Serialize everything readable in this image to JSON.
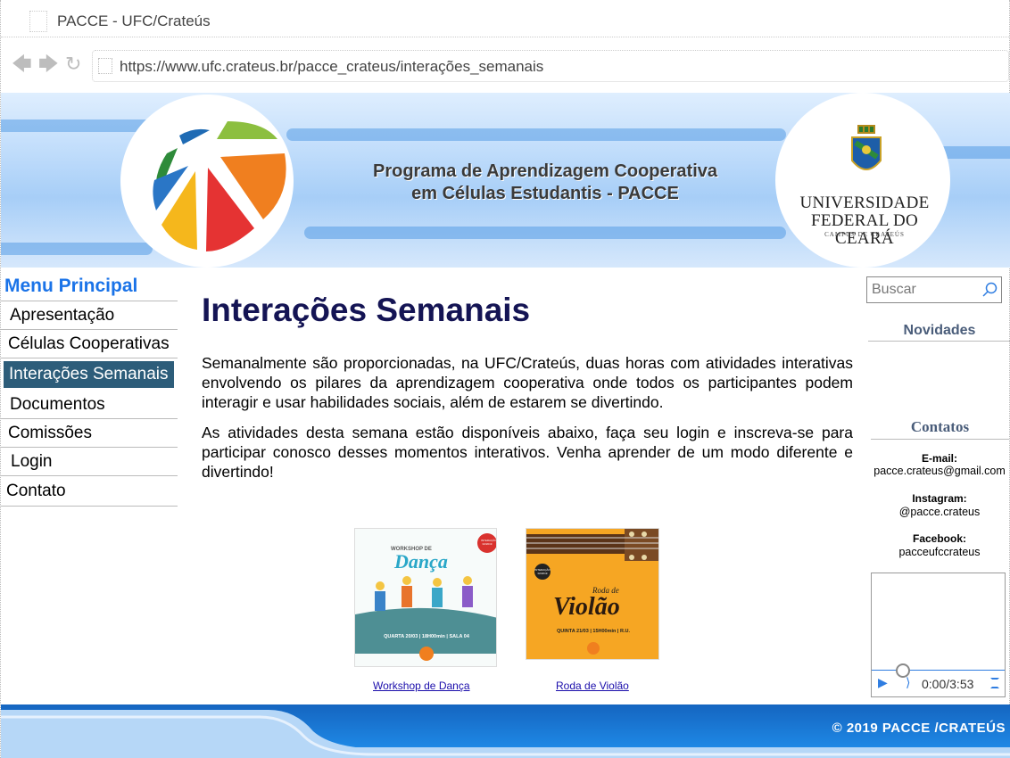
{
  "browser": {
    "tab_title": "PACCE - UFC/Crateús",
    "url": "https://www.ufc.crateus.br/pacce_crateus/interações_semanais"
  },
  "banner": {
    "program_line1": "Programa de Aprendizagem Cooperativa",
    "program_line2": "em Células Estudantis - PACCE",
    "university_line1": "UNIVERSIDADE",
    "university_line2": "FEDERAL DO CEARÁ",
    "university_campus": "CAMPUS DE CRATEÚS"
  },
  "menu": {
    "title": "Menu Principal",
    "items": [
      {
        "label": "Apresentação"
      },
      {
        "label": "Células Cooperativas"
      },
      {
        "label": "Interações Semanais",
        "active": true
      },
      {
        "label": "Documentos"
      },
      {
        "label": "Comissões"
      },
      {
        "label": "Login"
      },
      {
        "label": "Contato"
      }
    ]
  },
  "main": {
    "title": "Interações Semanais",
    "paragraph1": "Semanalmente são proporcionadas, na UFC/Crateús, duas horas  com atividades interativas envolvendo os pilares da aprendizagem cooperativa onde todos os participantes podem interagir e usar habilidades sociais, além de estarem se divertindo.",
    "paragraph2": "As atividades desta semana estão disponíveis abaixo, faça seu login e inscreva-se para participar conosco desses momentos interativos. Venha aprender de um modo diferente e divertindo!",
    "cards": [
      {
        "link": "Workshop de Dança",
        "poster_top": "WORKSHOP DE",
        "poster_title": "Dança",
        "poster_info": "QUARTA 20/03 | 18H00min | SALA 04",
        "badge": "INTERAÇÃO 02/2019"
      },
      {
        "link": "Roda de Violão",
        "poster_top": "Roda de",
        "poster_title": "Violão",
        "poster_info": "QUINTA 21/03 | 15H00min | R.U.",
        "badge": "INTERAÇÃO 02/2019"
      }
    ]
  },
  "sidebar": {
    "search_placeholder": "Buscar",
    "news_title": "Novidades",
    "contacts_title": "Contatos",
    "email_label": "E-mail:",
    "email_value": "pacce.crateus@gmail.com",
    "instagram_label": "Instagram:",
    "instagram_value": "@pacce.crateus",
    "facebook_label": "Facebook:",
    "facebook_value": "pacceufccrateus",
    "player_time": "0:00/3:53",
    "player_progress": 0
  },
  "footer": {
    "copyright": "© 2019 PACCE /CRATEÚS"
  },
  "colors": {
    "menu_title": "#1a73e8",
    "active_menu_bg": "#2d5d7a",
    "heading": "#141454",
    "footer": "#1565c0"
  }
}
